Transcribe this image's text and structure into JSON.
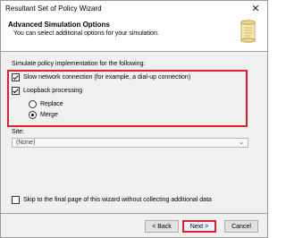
{
  "window": {
    "title": "Resultant Set of Policy Wizard",
    "close_glyph": "✕"
  },
  "header": {
    "title": "Advanced Simulation Options",
    "subtitle": "You can select additional options for your simulation.",
    "icon": "scroll-icon"
  },
  "options": {
    "prompt": "Simulate policy implementation for the following:",
    "slow_network": {
      "label": "Slow network connection (for example, a dial-up connection)",
      "checked": true
    },
    "loopback": {
      "label": "Loopback processing",
      "checked": true
    },
    "replace": {
      "label": "Replace",
      "selected": false
    },
    "merge": {
      "label": "Merge",
      "selected": true
    }
  },
  "site": {
    "label": "Site:",
    "value": "(None)"
  },
  "skip": {
    "label": "Skip to the final page of this wizard without collecting additional data",
    "checked": false
  },
  "buttons": {
    "back": "< Back",
    "next": "Next >",
    "cancel": "Cancel"
  },
  "colors": {
    "highlight": "#e0202a",
    "window_bg": "#f0f0f0"
  }
}
